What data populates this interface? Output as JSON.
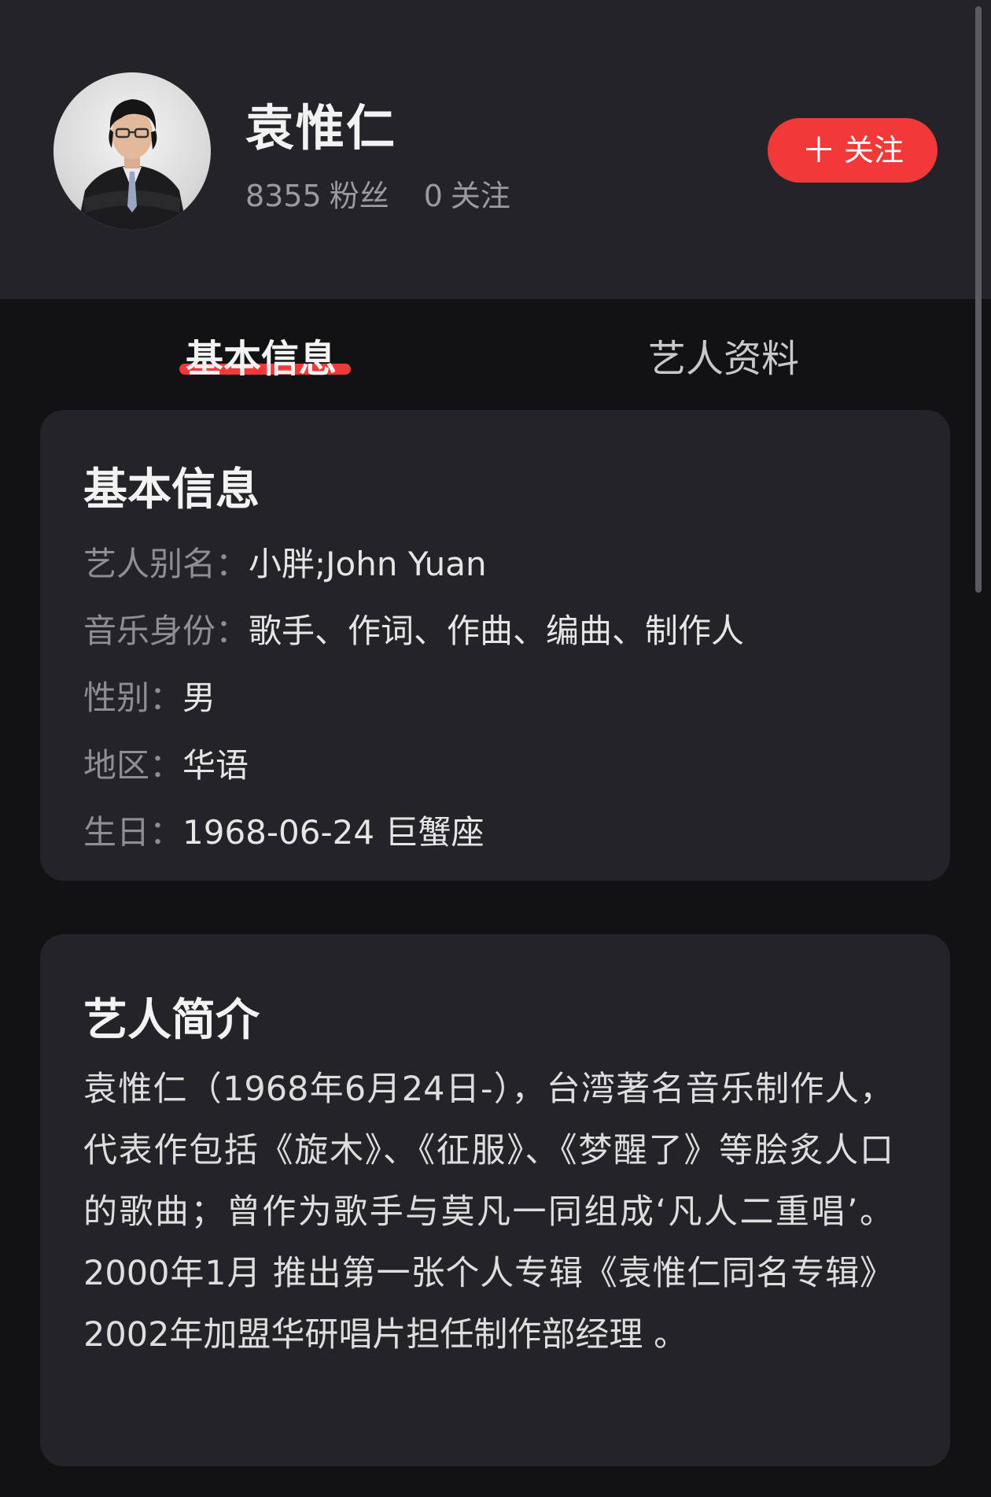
{
  "header": {
    "artist_name": "袁惟仁",
    "fans_count": "8355",
    "fans_label": "粉丝",
    "following_count": "0",
    "following_label": "关注",
    "follow_button": {
      "icon": "plus-icon",
      "label": "关注"
    }
  },
  "tabs": [
    {
      "label": "基本信息",
      "active": true
    },
    {
      "label": "艺人资料",
      "active": false
    }
  ],
  "basic_info": {
    "title": "基本信息",
    "rows": [
      {
        "label": "艺人别名：",
        "value": "小胖;John Yuan"
      },
      {
        "label": "音乐身份：",
        "value": "歌手、作词、作曲、编曲、制作人"
      },
      {
        "label": "性别：",
        "value": "男"
      },
      {
        "label": "地区：",
        "value": "华语"
      },
      {
        "label": "生日：",
        "value": "1968-06-24 巨蟹座"
      }
    ]
  },
  "intro": {
    "title": "艺人简介",
    "text": "袁惟仁（1968年6月24日-），台湾著名音乐制作人，代表作包括《旋木》、《征服》、《梦醒了》等脍炙人口的歌曲；曾作为歌手与莫凡一同组成‘凡人二重唱’。2000年1月 推出第一张个人专辑《袁惟仁同名专辑》 2002年加盟华研唱片担任制作部经理 。"
  },
  "colors": {
    "accent": "#f2393a",
    "header_bg": "#242428",
    "page_bg": "#121214",
    "card_bg": "#242428",
    "label_gray": "#8e8e93"
  }
}
